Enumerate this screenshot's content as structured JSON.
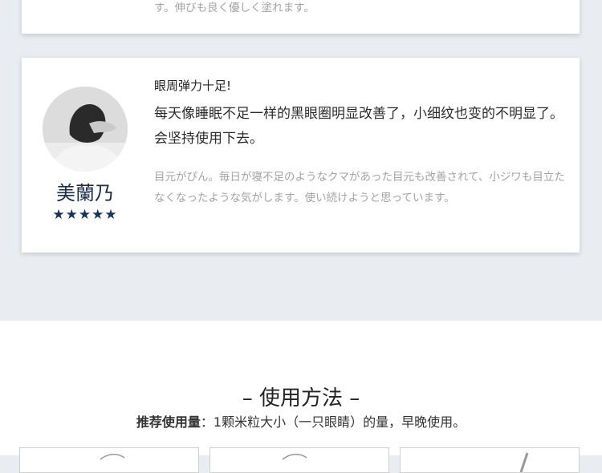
{
  "previous_review": {
    "japanese_text_tail": "す。伸びも良く優しく塗れます。"
  },
  "review": {
    "reviewer_name": "美蘭乃",
    "rating": 5,
    "stars_display": "★★★★★",
    "title": "眼周弹力十足!",
    "body_chinese": "每天像睡眠不足一样的黑眼圈明显改善了，小细纹也变的不明显了。会坚持使用下去。",
    "body_japanese": "目元がぴん。毎日が寝不足のようなクマがあった目元も改善されて、小ジワも目立たなくなったような気がします。使い続けようと思っています。"
  },
  "usage": {
    "section_title": "– 使用方法 –",
    "recommended_label": "推荐使用量",
    "recommended_text": "：1颗米粒大小（一只眼睛）的量，早晚使用。"
  },
  "colors": {
    "page_background": "#e9edf1",
    "card_background": "#ffffff",
    "star_color": "#16355e",
    "name_color": "#1d2f4a"
  }
}
